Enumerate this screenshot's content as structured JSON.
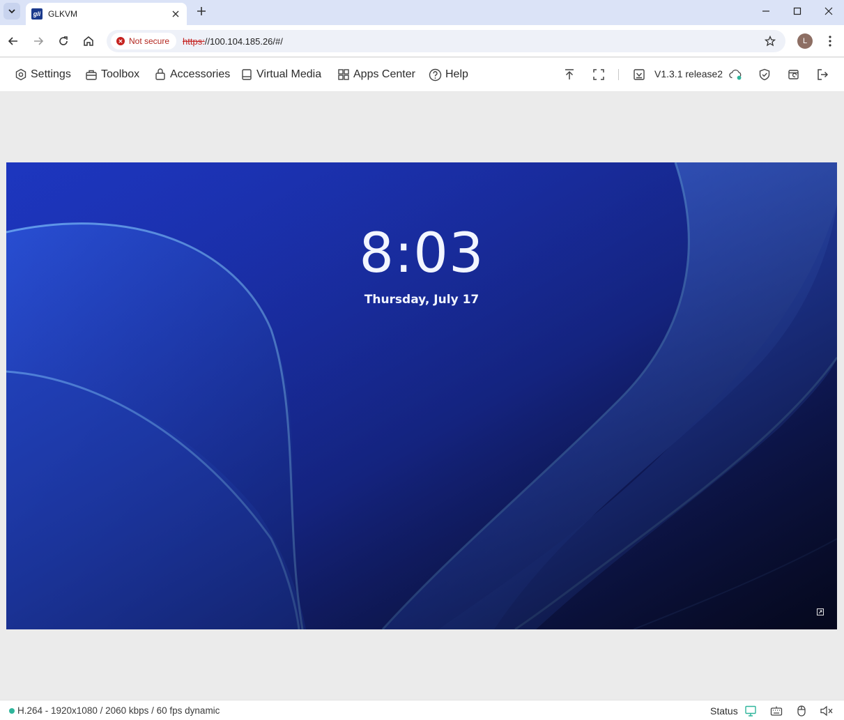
{
  "browser": {
    "tab_title": "GLKVM",
    "favicon_text": "gli",
    "security_label": "Not secure",
    "url_scheme": "https:",
    "url_rest": "//100.104.185.26/#/",
    "profile_initial": "L"
  },
  "toolbar": {
    "settings": "Settings",
    "toolbox": "Toolbox",
    "accessories": "Accessories",
    "virtual_media": "Virtual Media",
    "apps_center": "Apps Center",
    "help": "Help",
    "version": "V1.3.1 release2"
  },
  "screen": {
    "time": "8:03",
    "date": "Thursday, July 17"
  },
  "status_bar": {
    "stream_info": "H.264 - 1920x1080 / 2060 kbps / 60 fps dynamic",
    "status_label": "Status"
  },
  "colors": {
    "accent_teal": "#2fb59b",
    "not_secure_red": "#c5221f",
    "wallpaper_blue": "#1a34b8"
  }
}
